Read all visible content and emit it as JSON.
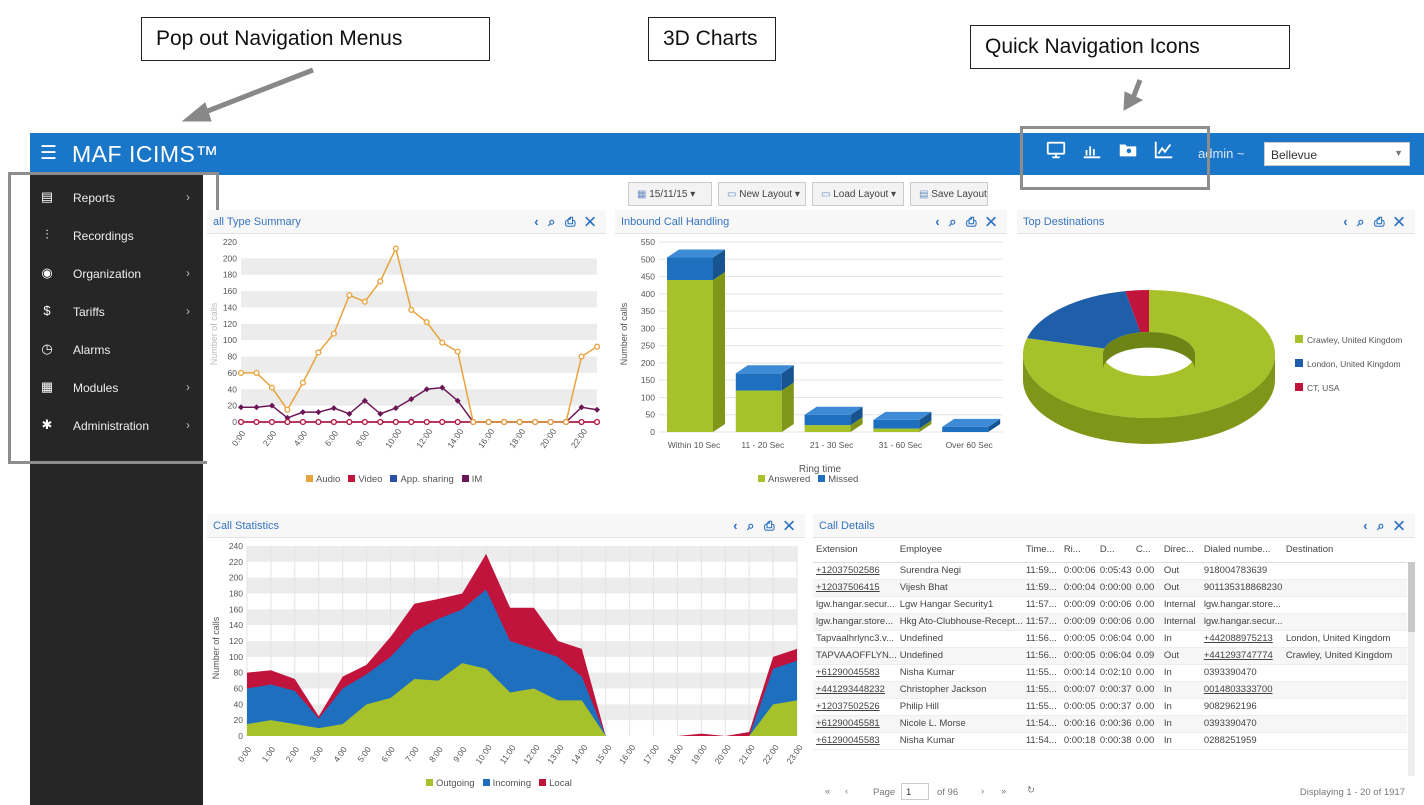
{
  "callouts": {
    "nav": "Pop out Navigation Menus",
    "charts": "3D Charts",
    "quick": "Quick Navigation Icons"
  },
  "header": {
    "brand": "MAF ICIMS™",
    "user": "admin ~",
    "branch": "Bellevue",
    "quick_icons": [
      "monitor-icon",
      "bar-chart-icon",
      "folder-star-icon",
      "line-chart-icon"
    ]
  },
  "sidebar": {
    "items": [
      {
        "label": "Reports",
        "icon": "report-icon",
        "has_submenu": true
      },
      {
        "label": "Recordings",
        "icon": "waveform-icon",
        "has_submenu": false
      },
      {
        "label": "Organization",
        "icon": "globe-icon",
        "has_submenu": true
      },
      {
        "label": "Tariffs",
        "icon": "dollar-icon",
        "has_submenu": true
      },
      {
        "label": "Alarms",
        "icon": "alarm-icon",
        "has_submenu": false
      },
      {
        "label": "Modules",
        "icon": "modules-icon",
        "has_submenu": true
      },
      {
        "label": "Administration",
        "icon": "gear-icon",
        "has_submenu": true
      }
    ]
  },
  "toolbar": {
    "date": "15/11/15 ▾",
    "new_layout": "New Layout ▾",
    "load_layout": "Load Layout ▾",
    "save_layout": "Save Layout"
  },
  "panels": {
    "call_type": "all Type Summary",
    "inbound": "Inbound Call Handling",
    "top_dest": "Top Destinations",
    "call_stats": "Call Statistics",
    "call_details": "Call Details"
  },
  "chart_data": [
    {
      "type": "line",
      "title": "all Type Summary",
      "ylabel": "Number of calls",
      "ylim": [
        0,
        220
      ],
      "yticks": [
        0,
        20,
        40,
        60,
        80,
        100,
        120,
        140,
        160,
        180,
        200,
        220
      ],
      "categories": [
        "0:00",
        "1:00",
        "2:00",
        "3:00",
        "4:00",
        "5:00",
        "6:00",
        "7:00",
        "8:00",
        "9:00",
        "10:00",
        "11:00",
        "12:00",
        "13:00",
        "14:00",
        "15:00",
        "16:00",
        "17:00",
        "18:00",
        "19:00",
        "20:00",
        "21:00",
        "22:00",
        "23:00"
      ],
      "xtick_labels": [
        "0:00",
        "2:00",
        "4:00",
        "6:00",
        "8:00",
        "10:00",
        "12:00",
        "14:00",
        "16:00",
        "18:00",
        "20:00",
        "22:00"
      ],
      "series": [
        {
          "name": "Audio",
          "color": "#e8a33d",
          "values": [
            60,
            60,
            42,
            15,
            48,
            85,
            108,
            155,
            147,
            172,
            212,
            137,
            122,
            97,
            86,
            0,
            0,
            0,
            0,
            0,
            0,
            0,
            80,
            92
          ]
        },
        {
          "name": "Video",
          "color": "#c0143c",
          "values": [
            0,
            0,
            0,
            0,
            0,
            0,
            0,
            0,
            0,
            0,
            0,
            0,
            0,
            0,
            0,
            0,
            0,
            0,
            0,
            0,
            0,
            0,
            0,
            0
          ]
        },
        {
          "name": "App. sharing",
          "color": "#2b4ea8",
          "values": [
            0,
            0,
            0,
            0,
            0,
            0,
            0,
            0,
            0,
            0,
            0,
            0,
            0,
            0,
            0,
            0,
            0,
            0,
            0,
            0,
            0,
            0,
            0,
            0
          ]
        },
        {
          "name": "IM",
          "color": "#6b1757",
          "values": [
            18,
            18,
            20,
            5,
            12,
            12,
            17,
            10,
            26,
            10,
            17,
            28,
            40,
            42,
            26,
            0,
            0,
            0,
            0,
            0,
            0,
            0,
            18,
            15
          ]
        }
      ]
    },
    {
      "type": "bar",
      "title": "Inbound Call Handling",
      "xlabel": "Ring time",
      "ylabel": "Number of calls",
      "ylim": [
        0,
        550
      ],
      "yticks": [
        0,
        50,
        100,
        150,
        200,
        250,
        300,
        350,
        400,
        450,
        500,
        550
      ],
      "categories": [
        "Within 10 Sec",
        "11 - 20 Sec",
        "21 - 30 Sec",
        "31 - 60 Sec",
        "Over 60 Sec"
      ],
      "series": [
        {
          "name": "Answered",
          "color": "#a7c12a",
          "values": [
            440,
            120,
            20,
            10,
            0
          ]
        },
        {
          "name": "Missed",
          "color": "#1f6fbf",
          "values": [
            65,
            50,
            30,
            25,
            15
          ]
        }
      ]
    },
    {
      "type": "pie",
      "title": "Top Destinations",
      "labels": [
        "Crawley, United Kingdom",
        "London, United Kingdom",
        "CT, USA"
      ],
      "colors": [
        "#a7c12a",
        "#1f5ea8",
        "#c0143c"
      ],
      "values": [
        79,
        18,
        3
      ]
    },
    {
      "type": "area",
      "title": "Call Statistics",
      "ylabel": "Number of calls",
      "ylim": [
        0,
        240
      ],
      "yticks": [
        0,
        20,
        40,
        60,
        80,
        100,
        120,
        140,
        160,
        180,
        200,
        220,
        240
      ],
      "categories": [
        "0:00",
        "1:00",
        "2:00",
        "3:00",
        "4:00",
        "5:00",
        "6:00",
        "7:00",
        "8:00",
        "9:00",
        "10:00",
        "11:00",
        "12:00",
        "13:00",
        "14:00",
        "15:00",
        "16:00",
        "17:00",
        "18:00",
        "19:00",
        "20:00",
        "21:00",
        "22:00",
        "23:00"
      ],
      "series": [
        {
          "name": "Outgoing",
          "color": "#a7c12a",
          "values": [
            15,
            20,
            15,
            10,
            15,
            40,
            48,
            72,
            70,
            92,
            85,
            55,
            60,
            45,
            45,
            0,
            0,
            0,
            0,
            0,
            0,
            0,
            40,
            45
          ]
        },
        {
          "name": "Incoming",
          "color": "#1f6fbf",
          "values": [
            45,
            45,
            42,
            12,
            45,
            38,
            52,
            60,
            78,
            68,
            100,
            65,
            50,
            55,
            30,
            0,
            0,
            0,
            0,
            0,
            0,
            0,
            45,
            50
          ]
        },
        {
          "name": "Local",
          "color": "#c0143c",
          "values": [
            20,
            18,
            15,
            3,
            15,
            12,
            25,
            35,
            25,
            20,
            45,
            42,
            52,
            20,
            35,
            0,
            0,
            0,
            0,
            3,
            0,
            5,
            15,
            15
          ]
        }
      ]
    }
  ],
  "call_details": {
    "columns": [
      "Extension",
      "Employee",
      "Time...",
      "Ri...",
      "D...",
      "C...",
      "Direc...",
      "Dialed numbe...",
      "Destination"
    ],
    "rows": [
      [
        "+12037502586",
        "Surendra Negi",
        "11:59...",
        "0:00:06",
        "0:05:43",
        "0.00",
        "Out",
        "918004783639",
        ""
      ],
      [
        "+12037506415",
        "Vijesh Bhat",
        "11:59...",
        "0:00:04",
        "0:00:00",
        "0.00",
        "Out",
        "901135318868230",
        ""
      ],
      [
        "lgw.hangar.secur...",
        "Lgw Hangar Security1",
        "11:57...",
        "0:00:09",
        "0:00:06",
        "0.00",
        "Internal",
        "lgw.hangar.store...",
        ""
      ],
      [
        "lgw.hangar.store...",
        "Hkg Ato-Clubhouse-Recept...",
        "11:57...",
        "0:00:09",
        "0:00:06",
        "0.00",
        "Internal",
        "lgw.hangar.secur...",
        ""
      ],
      [
        "Tapvaalhrlync3.v...",
        "Undefined",
        "11:56...",
        "0:00:05",
        "0:06:04",
        "0.00",
        "In",
        "+442088975213",
        "London, United Kingdom"
      ],
      [
        "TAPVAAOFFLYN...",
        "Undefined",
        "11:56...",
        "0:00:05",
        "0:06:04",
        "0.09",
        "Out",
        "+441293747774",
        "Crawley, United Kingdom"
      ],
      [
        "+61290045583",
        "Nisha Kumar",
        "11:55...",
        "0:00:14",
        "0:02:10",
        "0.00",
        "In",
        "0393390470",
        ""
      ],
      [
        "+441293448232",
        "Christopher Jackson",
        "11:55...",
        "0:00:07",
        "0:00:37",
        "0.00",
        "In",
        "0014803333700",
        ""
      ],
      [
        "+12037502526",
        "Philip Hill",
        "11:55...",
        "0:00:05",
        "0:00:37",
        "0.00",
        "In",
        "9082962196",
        ""
      ],
      [
        "+61290045581",
        "Nicole L. Morse",
        "11:54...",
        "0:00:16",
        "0:00:36",
        "0.00",
        "In",
        "0393390470",
        ""
      ],
      [
        "+61290045583",
        "Nisha Kumar",
        "11:54...",
        "0:00:18",
        "0:00:38",
        "0.00",
        "In",
        "0288251959",
        ""
      ]
    ],
    "link_ext": [
      true,
      true,
      false,
      false,
      false,
      false,
      true,
      true,
      true,
      true,
      true
    ],
    "link_dial": [
      false,
      false,
      false,
      false,
      true,
      true,
      false,
      true,
      false,
      false,
      false
    ],
    "pager": {
      "page_label": "Page",
      "page": "1",
      "of": "of 96",
      "displaying": "Displaying 1 - 20 of 1917"
    }
  }
}
